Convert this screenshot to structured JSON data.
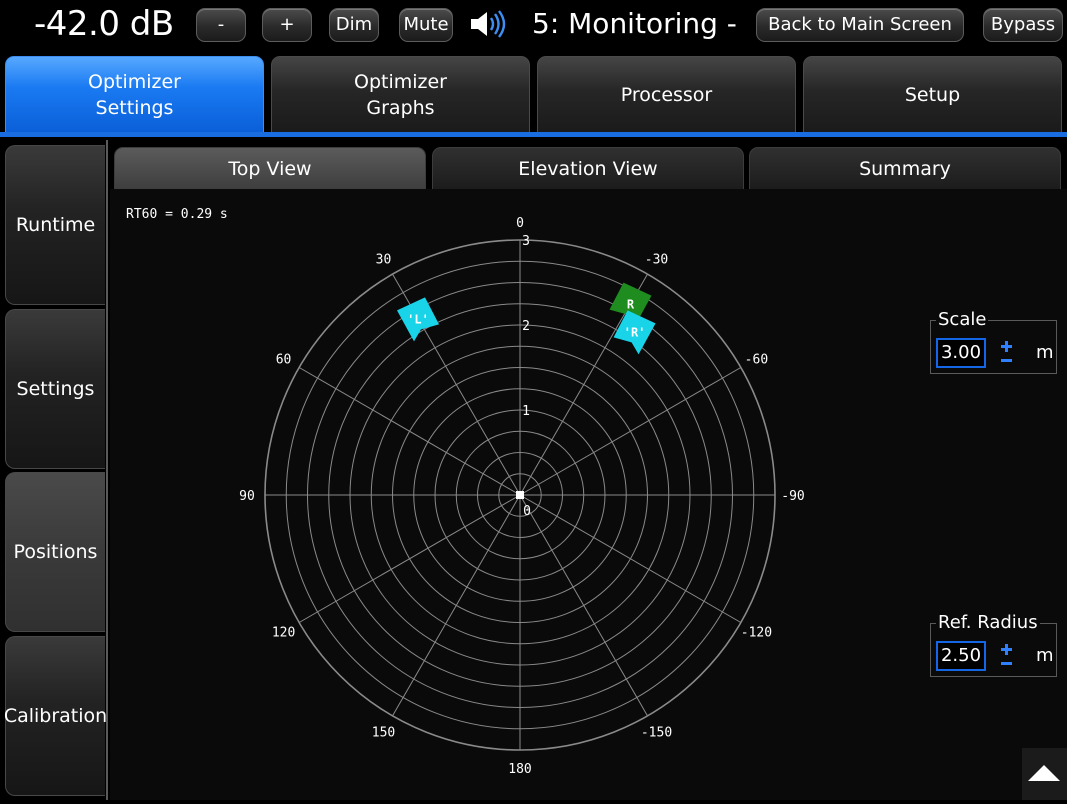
{
  "header": {
    "level": "-42.0 dB",
    "minus_label": "-",
    "plus_label": "+",
    "dim_label": "Dim",
    "mute_label": "Mute",
    "speaker_icon": "speaker-volume-icon",
    "preset_title": "5: Monitoring -",
    "back_label": "Back to Main Screen",
    "bypass_label": "Bypass"
  },
  "main_tabs": [
    {
      "label": "Optimizer\nSettings",
      "active": true
    },
    {
      "label": "Optimizer\nGraphs",
      "active": false
    },
    {
      "label": "Processor",
      "active": false
    },
    {
      "label": "Setup",
      "active": false
    }
  ],
  "side_nav": [
    {
      "label": "Runtime",
      "active": false
    },
    {
      "label": "Settings",
      "active": false
    },
    {
      "label": "Positions",
      "active": true
    },
    {
      "label": "Calibration",
      "active": false
    }
  ],
  "sub_tabs": [
    {
      "label": "Top View",
      "active": true
    },
    {
      "label": "Elevation View",
      "active": false
    },
    {
      "label": "Summary",
      "active": false
    }
  ],
  "rt60": "RT60 = 0.29 s",
  "plot": {
    "angle_labels": [
      "0",
      "-30",
      "-60",
      "-90",
      "-120",
      "-150",
      "180",
      "150",
      "120",
      "90",
      "60",
      "30"
    ],
    "radius_labels": [
      "1",
      "2",
      "3"
    ],
    "center_label": "0",
    "speakers": [
      {
        "label": "R",
        "angle_deg": -30,
        "distance_m": 2.6,
        "color": "#1e8c1e"
      },
      {
        "label": "'R'",
        "angle_deg": -35,
        "distance_m": 2.35,
        "color": "#19d3e8"
      },
      {
        "label": "'L'",
        "angle_deg": 30,
        "distance_m": 2.4,
        "color": "#19d3e8"
      }
    ],
    "colors": {
      "ring": "#8a8a8a",
      "spoke": "#8a8a8a",
      "center": "#ffffff"
    }
  },
  "controls": {
    "scale": {
      "label": "Scale",
      "value": "3.00",
      "unit": "m"
    },
    "ref_radius": {
      "label": "Ref. Radius",
      "value": "2.50",
      "unit": "m"
    }
  },
  "icons": {
    "stepper": "plus-minus-icon",
    "scroll": "triangle-up-icon"
  }
}
